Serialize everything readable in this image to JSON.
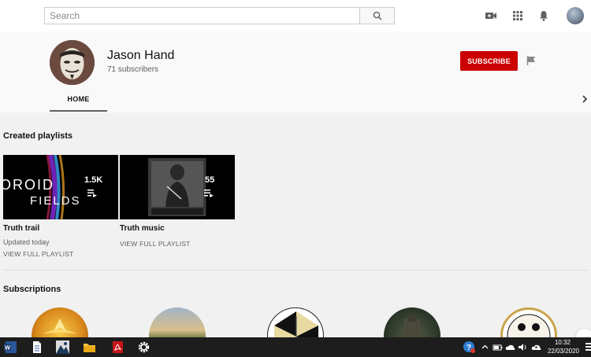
{
  "search": {
    "placeholder": "Search",
    "value": ""
  },
  "masthead": {
    "icons": [
      "create-video-icon",
      "apps-grid-icon",
      "notifications-bell-icon",
      "account-avatar"
    ]
  },
  "channel": {
    "name": "Jason Hand",
    "subscribers": "71 subscribers",
    "subscribe_label": "SUBSCRIBE",
    "tabs": [
      {
        "label": "HOME",
        "selected": true
      }
    ]
  },
  "sections": {
    "playlists_title": "Created playlists",
    "subscriptions_title": "Subscriptions"
  },
  "playlists": [
    {
      "title": "Truth trail",
      "count": "1.5K",
      "updated": "Updated today",
      "link": "VIEW FULL PLAYLIST",
      "thumb_text": [
        "OROID",
        "FIELDS"
      ]
    },
    {
      "title": "Truth music",
      "count": "55",
      "updated": "",
      "link": "VIEW FULL PLAYLIST"
    }
  ],
  "taskbar": {
    "time": "10:32",
    "date": "22/03/2020",
    "apps": [
      "word-icon",
      "document-icon",
      "photo-app-icon",
      "file-explorer-icon",
      "pdf-reader-icon",
      "settings-gear-icon"
    ]
  },
  "colors": {
    "accent": "#cc0000",
    "page_bg": "#f1f1f1",
    "header_bg": "#f9f9f9",
    "taskbar_bg": "#1d1d1d"
  }
}
